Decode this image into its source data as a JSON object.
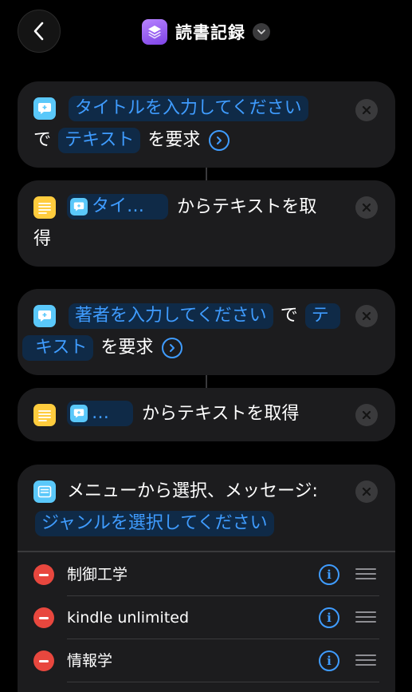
{
  "header": {
    "title": "読書記録"
  },
  "actions": [
    {
      "id": "ask1",
      "token": "タイトルを入力してください",
      "connector": "で",
      "type_token": "テキスト",
      "suffix": "を要求"
    },
    {
      "id": "get1",
      "var_token": "タイ…",
      "suffix_line1": "からテキストを取",
      "suffix_line2": "得"
    },
    {
      "id": "ask2",
      "token": "著者を入力してください",
      "connector": "で",
      "type_token_part1": "テ",
      "type_token_part2": "キスト",
      "suffix": "を要求"
    },
    {
      "id": "get2",
      "var_token": "…",
      "suffix": "からテキストを取得"
    },
    {
      "id": "menu",
      "prefix": "メニューから選択、メッセージ:",
      "token": "ジャンルを選択してください",
      "items": [
        {
          "label": "制御工学"
        },
        {
          "label": "kindle unlimited"
        },
        {
          "label": "情報学"
        }
      ]
    }
  ],
  "colors": {
    "accent": "#3f9cff",
    "card": "#1c1c1e",
    "delete": "#e8473e",
    "ask_icon": "#5ac8fa",
    "text_icon": "#ffcc3d",
    "app_icon": "#9a5cf5"
  }
}
